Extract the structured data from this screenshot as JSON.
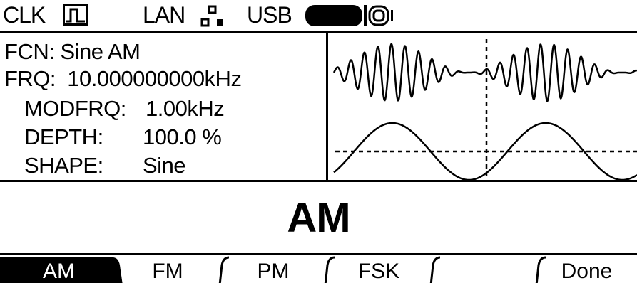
{
  "status_bar": {
    "clk_label": "CLK",
    "lan_label": "LAN",
    "usb_label": "USB"
  },
  "params": {
    "fcn_label": "FCN:",
    "fcn_value": "Sine AM",
    "frq_label": "FRQ:",
    "frq_value": "10.000000000kHz",
    "modfrq_label": "MODFRQ:",
    "modfrq_value": "1.00kHz",
    "depth_label": "DEPTH:",
    "depth_value": "100.0 %",
    "shape_label": "SHAPE:",
    "shape_value": "Sine"
  },
  "mode_title": "AM",
  "softkeys": [
    "AM",
    "FM",
    "PM",
    "FSK",
    "",
    "Done"
  ],
  "selected_softkey": 0,
  "colors": {
    "foreground": "#000000",
    "background": "#ffffff"
  },
  "icons": {
    "clk": "square-wave-icon",
    "lan": "network-icon",
    "usb": "usb-stick-icon"
  }
}
